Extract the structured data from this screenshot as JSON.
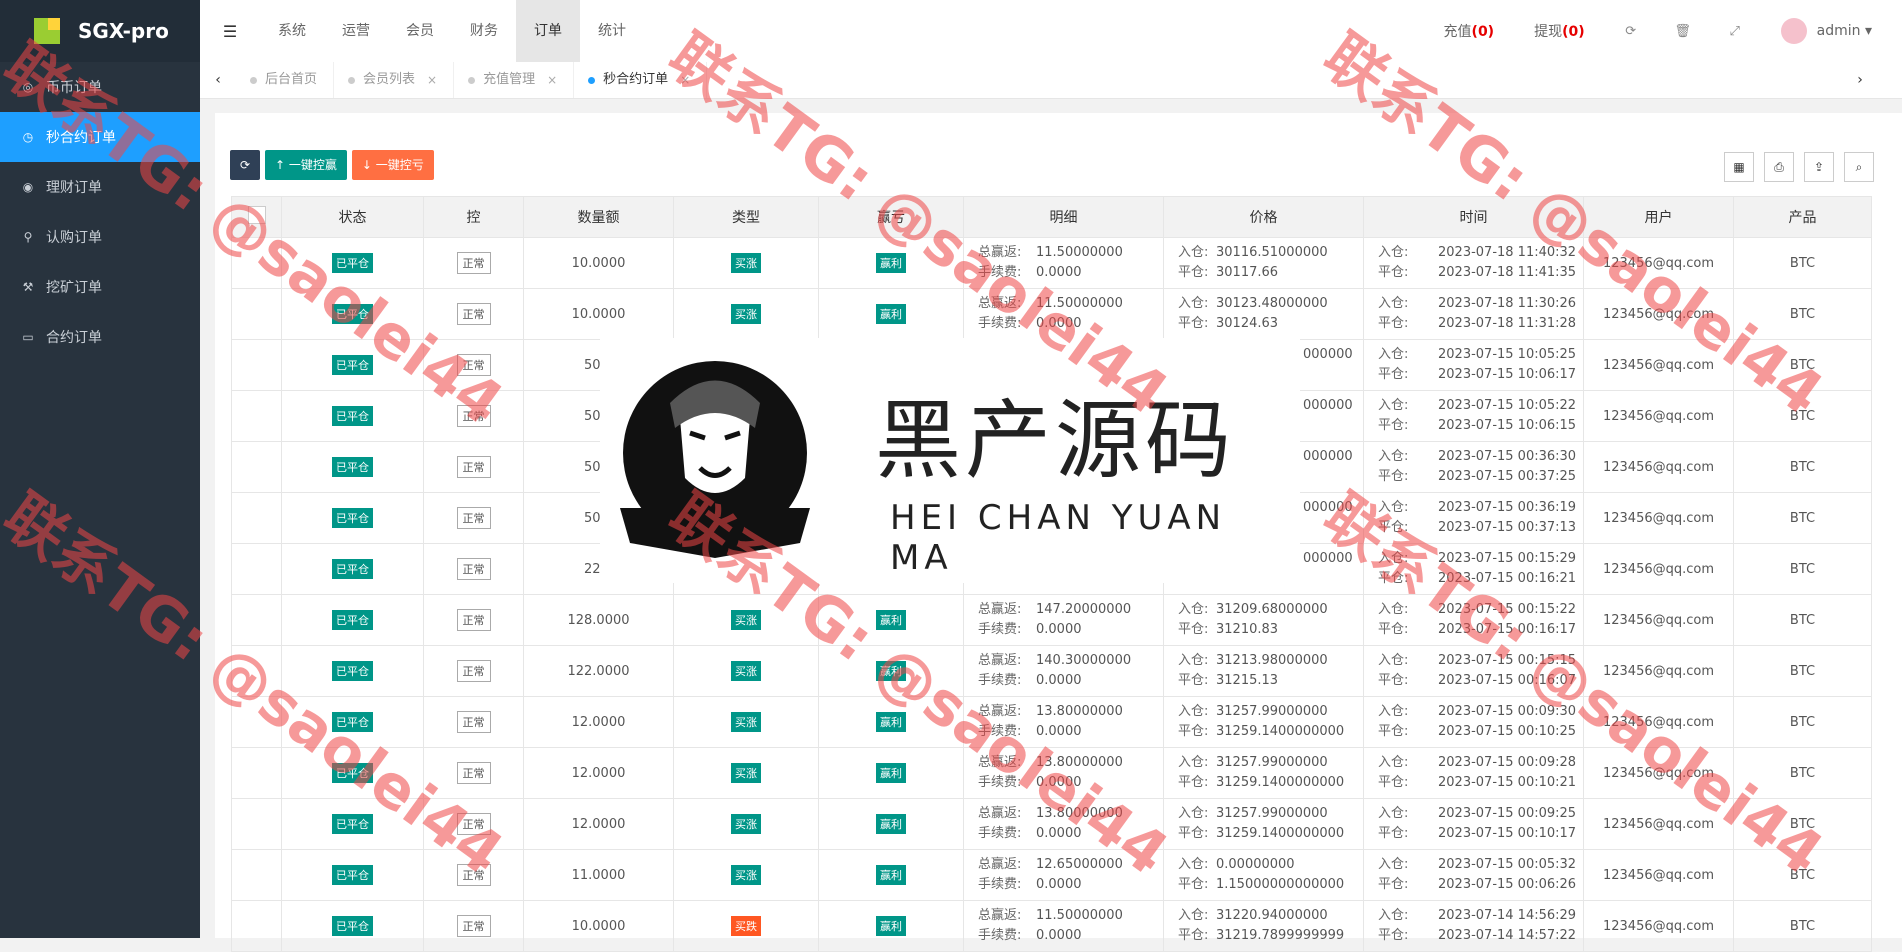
{
  "app": {
    "name": "SGX-pro"
  },
  "sidebar": {
    "items": [
      {
        "label": "币币订单",
        "icon": "coin-icon"
      },
      {
        "label": "秒合约订单",
        "icon": "clock-icon",
        "active": true
      },
      {
        "label": "理财订单",
        "icon": "finance-icon"
      },
      {
        "label": "认购订单",
        "icon": "walk-icon"
      },
      {
        "label": "挖矿订单",
        "icon": "mining-icon"
      },
      {
        "label": "合约订单",
        "icon": "monitor-icon"
      }
    ]
  },
  "topnav": {
    "items": [
      "系统",
      "运营",
      "会员",
      "财务",
      "订单",
      "统计"
    ],
    "active": "订单"
  },
  "topright": {
    "recharge_label": "充值",
    "recharge_count": "(0)",
    "withdraw_label": "提现",
    "withdraw_count": "(0)",
    "user": "admin"
  },
  "tabs": [
    {
      "label": "后台首页"
    },
    {
      "label": "会员列表"
    },
    {
      "label": "充值管理"
    },
    {
      "label": "秒合约订单",
      "active": true
    }
  ],
  "toolbar": {
    "btn_win": "一键控赢",
    "btn_lose": "一键控亏"
  },
  "table": {
    "headers": [
      "状态",
      "控",
      "数量额",
      "类型",
      "赢亏",
      "明细",
      "价格",
      "时间",
      "用户",
      "产品"
    ],
    "labels": {
      "detail1": "总赢返:",
      "detail2": "手续费:",
      "price1": "入仓:",
      "price2": "平仓:",
      "time1": "入仓:",
      "time2": "平仓:"
    },
    "rows": [
      {
        "status": "已平仓",
        "ctl": "正常",
        "amount": "10.0000",
        "type": "买涨",
        "pl": "赢利",
        "ret": "11.50000000",
        "fee": "0.0000",
        "in_price": "30116.51000000",
        "out_price": "30117.66",
        "in_time": "2023-07-18 11:40:32",
        "out_time": "2023-07-18 11:41:35",
        "user": "123456@qq.com",
        "product": "BTC"
      },
      {
        "status": "已平仓",
        "ctl": "正常",
        "amount": "10.0000",
        "type": "买涨",
        "pl": "赢利",
        "ret": "11.50000000",
        "fee": "0.0000",
        "in_price": "30123.48000000",
        "out_price": "30124.63",
        "in_time": "2023-07-18 11:30:26",
        "out_time": "2023-07-18 11:31:28",
        "user": "123456@qq.com",
        "product": "BTC"
      },
      {
        "status": "已平仓",
        "ctl": "正常",
        "amount": "500.",
        "type": "",
        "pl": "",
        "ret": "",
        "fee": "",
        "in_price": "000000",
        "out_price": "",
        "in_time": "2023-07-15 10:05:25",
        "out_time": "2023-07-15 10:06:17",
        "user": "123456@qq.com",
        "product": "BTC"
      },
      {
        "status": "已平仓",
        "ctl": "正常",
        "amount": "500.",
        "type": "",
        "pl": "",
        "ret": "",
        "fee": "",
        "in_price": "000000",
        "out_price": "",
        "in_time": "2023-07-15 10:05:22",
        "out_time": "2023-07-15 10:06:15",
        "user": "123456@qq.com",
        "product": "BTC"
      },
      {
        "status": "已平仓",
        "ctl": "正常",
        "amount": "500.",
        "type": "",
        "pl": "",
        "ret": "",
        "fee": "",
        "in_price": "000000",
        "out_price": "",
        "in_time": "2023-07-15 00:36:30",
        "out_time": "2023-07-15 00:37:25",
        "user": "123456@qq.com",
        "product": "BTC"
      },
      {
        "status": "已平仓",
        "ctl": "正常",
        "amount": "500.",
        "type": "",
        "pl": "",
        "ret": "",
        "fee": "",
        "in_price": "000000",
        "out_price": "",
        "in_time": "2023-07-15 00:36:19",
        "out_time": "2023-07-15 00:37:13",
        "user": "123456@qq.com",
        "product": "BTC"
      },
      {
        "status": "已平仓",
        "ctl": "正常",
        "amount": "222.",
        "type": "",
        "pl": "",
        "ret": "",
        "fee": "",
        "in_price": "000000",
        "out_price": "",
        "in_time": "2023-07-15 00:15:29",
        "out_time": "2023-07-15 00:16:21",
        "user": "123456@qq.com",
        "product": "BTC"
      },
      {
        "status": "已平仓",
        "ctl": "正常",
        "amount": "128.0000",
        "type": "买涨",
        "pl": "赢利",
        "ret": "147.20000000",
        "fee": "0.0000",
        "in_price": "31209.68000000",
        "out_price": "31210.83",
        "in_time": "2023-07-15 00:15:22",
        "out_time": "2023-07-15 00:16:17",
        "user": "123456@qq.com",
        "product": "BTC"
      },
      {
        "status": "已平仓",
        "ctl": "正常",
        "amount": "122.0000",
        "type": "买涨",
        "pl": "赢利",
        "ret": "140.30000000",
        "fee": "0.0000",
        "in_price": "31213.98000000",
        "out_price": "31215.13",
        "in_time": "2023-07-15 00:15:15",
        "out_time": "2023-07-15 00:16:07",
        "user": "123456@qq.com",
        "product": "BTC"
      },
      {
        "status": "已平仓",
        "ctl": "正常",
        "amount": "12.0000",
        "type": "买涨",
        "pl": "赢利",
        "ret": "13.80000000",
        "fee": "0.0000",
        "in_price": "31257.99000000",
        "out_price": "31259.1400000000",
        "in_time": "2023-07-15 00:09:30",
        "out_time": "2023-07-15 00:10:25",
        "user": "123456@qq.com",
        "product": "BTC"
      },
      {
        "status": "已平仓",
        "ctl": "正常",
        "amount": "12.0000",
        "type": "买涨",
        "pl": "赢利",
        "ret": "13.80000000",
        "fee": "0.0000",
        "in_price": "31257.99000000",
        "out_price": "31259.1400000000",
        "in_time": "2023-07-15 00:09:28",
        "out_time": "2023-07-15 00:10:21",
        "user": "123456@qq.com",
        "product": "BTC"
      },
      {
        "status": "已平仓",
        "ctl": "正常",
        "amount": "12.0000",
        "type": "买涨",
        "pl": "赢利",
        "ret": "13.80000000",
        "fee": "0.0000",
        "in_price": "31257.99000000",
        "out_price": "31259.1400000000",
        "in_time": "2023-07-15 00:09:25",
        "out_time": "2023-07-15 00:10:17",
        "user": "123456@qq.com",
        "product": "BTC"
      },
      {
        "status": "已平仓",
        "ctl": "正常",
        "amount": "11.0000",
        "type": "买涨",
        "pl": "赢利",
        "ret": "12.65000000",
        "fee": "0.0000",
        "in_price": "0.00000000",
        "out_price": "1.15000000000000",
        "in_time": "2023-07-15 00:05:32",
        "out_time": "2023-07-15 00:06:26",
        "user": "123456@qq.com",
        "product": "BTC"
      },
      {
        "status": "已平仓",
        "ctl": "正常",
        "amount": "10.0000",
        "type": "买跌",
        "pl": "赢利",
        "ret": "11.50000000",
        "fee": "0.0000",
        "in_price": "31220.94000000",
        "out_price": "31219.7899999999",
        "in_time": "2023-07-14 14:56:29",
        "out_time": "2023-07-14 14:57:22",
        "user": "123456@qq.com",
        "product": "BTC"
      }
    ]
  },
  "overlay": {
    "title_cn": "黑产源码",
    "title_en": "HEI CHAN YUAN MA"
  },
  "watermark": {
    "text": "联系TG: @saolei44"
  }
}
